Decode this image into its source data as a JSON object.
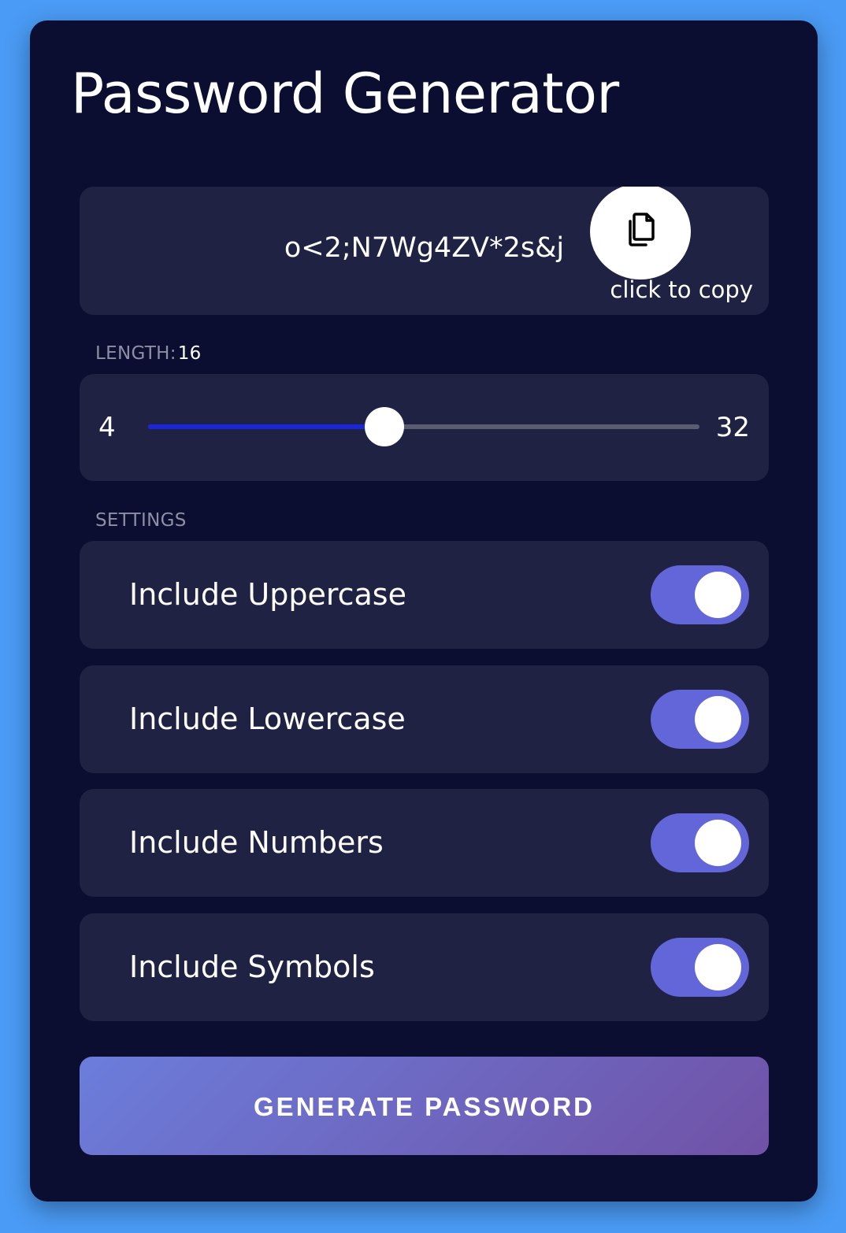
{
  "app": {
    "title": "Password Generator"
  },
  "result": {
    "password": "o<2;N7Wg4ZV*2s&j",
    "copy_icon": "clipboard-copy-icon",
    "copy_hint": "click to copy"
  },
  "length": {
    "label": "LENGTH:",
    "value": "16",
    "min": "4",
    "max": "32",
    "current": 16
  },
  "settings": {
    "label": "SETTINGS",
    "items": [
      {
        "label": "Include Uppercase",
        "enabled": true
      },
      {
        "label": "Include Lowercase",
        "enabled": true
      },
      {
        "label": "Include Numbers",
        "enabled": true
      },
      {
        "label": "Include Symbols",
        "enabled": true
      }
    ]
  },
  "actions": {
    "generate_label": "GENERATE PASSWORD"
  },
  "colors": {
    "page_background": "#4a9bf5",
    "card_background": "#0b0e30",
    "panel_background": "#1f2243",
    "slider_fill": "#1a27d8",
    "toggle_on": "#6366d8",
    "button_gradient_start": "#6b7ddb",
    "button_gradient_end": "#7052a6"
  }
}
